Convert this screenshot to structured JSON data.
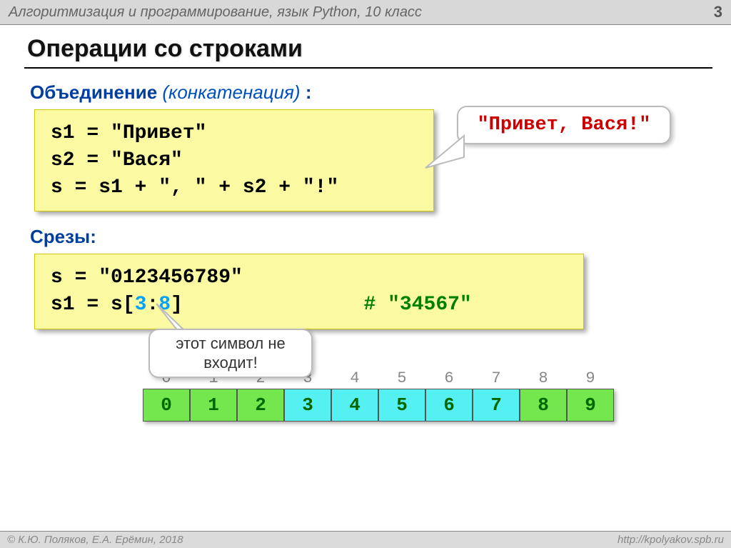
{
  "header": {
    "left": "Алгоритмизация и программирование, язык Python, 10 класс",
    "pagenum": "3"
  },
  "title": "Операции со строками",
  "section1": {
    "label": "Объединение",
    "em": "(конкатенация)",
    "after": " :",
    "code": {
      "l1": "s1 = \"Привет\"",
      "l2": "s2 = \"Вася\"",
      "l3": "s  = s1 + \", \" + s2 + \"!\""
    },
    "callout": "\"Привет, Вася!\""
  },
  "section2": {
    "label": "Срезы:",
    "code": {
      "l1": "s = \"0123456789\"",
      "l2a": "s1 = s[",
      "l2b": "3",
      "l2c": ":",
      "l2d": "8",
      "l2e": "]",
      "comment": "# \"34567\""
    },
    "annotation": "этот символ не входит!"
  },
  "strip": {
    "indices": [
      "0",
      "1",
      "2",
      "3",
      "4",
      "5",
      "6",
      "7",
      "8",
      "9"
    ],
    "cells": [
      "0",
      "1",
      "2",
      "3",
      "4",
      "5",
      "6",
      "7",
      "8",
      "9"
    ],
    "hl_start": 3,
    "hl_end": 7
  },
  "footer": {
    "left": "© К.Ю. Поляков, Е.А. Ерёмин, 2018",
    "right": "http://kpolyakov.spb.ru"
  }
}
